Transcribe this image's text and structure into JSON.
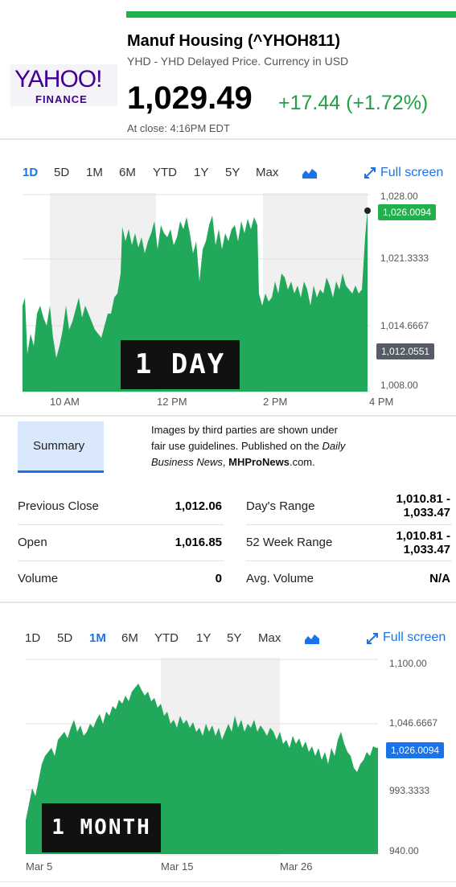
{
  "header": {
    "title": "Manuf Housing (^YHOH811)",
    "subtitle": "YHD - YHD Delayed Price. Currency in USD",
    "price": "1,029.49",
    "change": "+17.44 (+1.72%)",
    "close_time": "At close: 4:16PM EDT"
  },
  "logo": {
    "main": "YAHOO!",
    "sub": "FINANCE"
  },
  "range_tabs": [
    "1D",
    "5D",
    "1M",
    "6M",
    "YTD",
    "1Y",
    "5Y",
    "Max"
  ],
  "full_screen_label": "Full screen",
  "day_chart": {
    "stamp": "1 DAY",
    "yticks": [
      "1,028.00",
      "1,021.3333",
      "1,014.6667",
      "1,008.00"
    ],
    "xticks": [
      "10 AM",
      "12 PM",
      "2 PM",
      "4 PM"
    ],
    "last_tag": "1,026.0094",
    "prev_close_tag": "1,012.0551",
    "colors": {
      "fill": "#22a85a",
      "up_tag": "#21b04b",
      "prev_tag": "#555c66"
    }
  },
  "chart_data": [
    {
      "type": "area",
      "range": "1D",
      "ylim": [
        1008.0,
        1028.0
      ],
      "x": [
        "9:30",
        "10:00",
        "10:30",
        "11:00",
        "11:30",
        "12:00",
        "12:30",
        "13:00",
        "13:30",
        "14:00",
        "14:30",
        "15:00",
        "15:30",
        "15:55",
        "16:00"
      ],
      "values": [
        1016,
        1013,
        1014,
        1015.5,
        1023,
        1022.5,
        1024.5,
        1022.5,
        1023.5,
        1016.5,
        1018,
        1017.5,
        1017.5,
        1016.5,
        1026.0094
      ],
      "last_value": 1026.0094,
      "previous_close": 1012.0551
    },
    {
      "type": "area",
      "range": "1M",
      "ylim": [
        940.0,
        1100.0
      ],
      "x": [
        "Mar 5",
        "Mar 8",
        "Mar 12",
        "Mar 15",
        "Mar 18",
        "Mar 22",
        "Mar 26",
        "Mar 29",
        "Apr 1"
      ],
      "values": [
        960,
        1025,
        1050,
        1072,
        1055,
        1040,
        1030,
        1005,
        1026.0094
      ],
      "last_value": 1026.0094
    }
  ],
  "tabs": {
    "summary": "Summary"
  },
  "caption": {
    "line1": "Images by third parties are shown under",
    "line2a": "fair use guidelines.  Published on the ",
    "line2b": "Daily",
    "line3a": "Business News",
    "line3b": ", ",
    "line3c": "MHProNews",
    "line3d": ".com."
  },
  "stats": {
    "previous_close": {
      "label": "Previous Close",
      "value": "1,012.06"
    },
    "open": {
      "label": "Open",
      "value": "1,016.85"
    },
    "volume": {
      "label": "Volume",
      "value": "0"
    },
    "days_range": {
      "label": "Day's Range",
      "value_1": "1,010.81 -",
      "value_2": "1,033.47"
    },
    "week52_range": {
      "label": "52 Week Range",
      "value_1": "1,010.81 -",
      "value_2": "1,033.47"
    },
    "avg_volume": {
      "label": "Avg. Volume",
      "value": "N/A"
    }
  },
  "month_chart": {
    "stamp": "1 MONTH",
    "yticks": [
      "1,100.00",
      "1,046.6667",
      "993.3333",
      "940.00"
    ],
    "xticks": [
      "Mar 5",
      "Mar 15",
      "Mar 26"
    ],
    "last_tag": "1,026.0094",
    "colors": {
      "fill": "#22a85a",
      "tag": "#1a73e8"
    }
  }
}
